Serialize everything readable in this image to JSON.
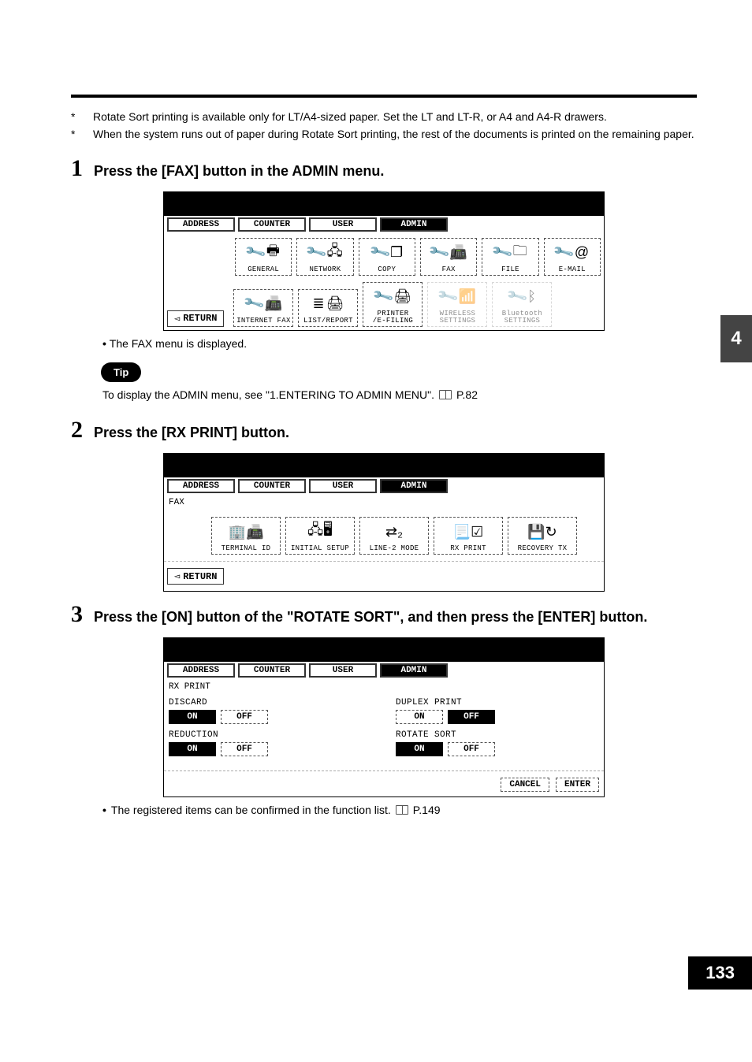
{
  "side_tab": "4",
  "page_number": "133",
  "notes": {
    "asterisk": "*",
    "n1": "Rotate Sort printing is available only for LT/A4-sized paper. Set the LT and LT-R, or A4 and A4-R drawers.",
    "n2": "When the system runs out of paper during Rotate Sort printing, the rest of the documents is printed on the remaining paper."
  },
  "steps": {
    "s1": {
      "num": "1",
      "text": "Press the [FAX] button in the ADMIN menu."
    },
    "s2": {
      "num": "2",
      "text": "Press the [RX PRINT] button."
    },
    "s3": {
      "num": "3",
      "text": "Press the [ON] button of the \"ROTATE SORT\", and then press the [ENTER] button."
    }
  },
  "screen1": {
    "tabs": {
      "address": "ADDRESS",
      "counter": "COUNTER",
      "user": "USER",
      "admin": "ADMIN"
    },
    "row1": {
      "general": "GENERAL",
      "network": "NETWORK",
      "copy": "COPY",
      "fax": "FAX",
      "file": "FILE",
      "email": "E-MAIL"
    },
    "row2": {
      "ifax": "INTERNET FAX",
      "list": "LIST/REPORT",
      "printer": "PRINTER\n/E-FILING",
      "wireless": "WIRELESS\nSETTINGS",
      "bt": "Bluetooth\nSETTINGS"
    },
    "return": "RETURN",
    "note": "The FAX menu is displayed."
  },
  "tip": {
    "label": "Tip",
    "text": "To display the ADMIN menu, see \"1.ENTERING TO ADMIN MENU\".",
    "page_ref": "P.82"
  },
  "screen2": {
    "sub": "FAX",
    "btns": {
      "terminal": "TERMINAL ID",
      "initial": "INITIAL SETUP",
      "line2": "LINE-2 MODE",
      "rxprint": "RX PRINT",
      "recovery": "RECOVERY TX"
    },
    "return": "RETURN"
  },
  "screen3": {
    "sub": "RX PRINT",
    "discard": {
      "title": "DISCARD",
      "on": "ON",
      "off": "OFF"
    },
    "duplex": {
      "title": "DUPLEX PRINT",
      "on": "ON",
      "off": "OFF"
    },
    "reduction": {
      "title": "REDUCTION",
      "on": "ON",
      "off": "OFF"
    },
    "rotate": {
      "title": "ROTATE SORT",
      "on": "ON",
      "off": "OFF"
    },
    "footer": {
      "cancel": "CANCEL",
      "enter": "ENTER"
    }
  },
  "final_note": {
    "text": "The registered items can be confirmed in the function list.",
    "page_ref": "P.149"
  }
}
